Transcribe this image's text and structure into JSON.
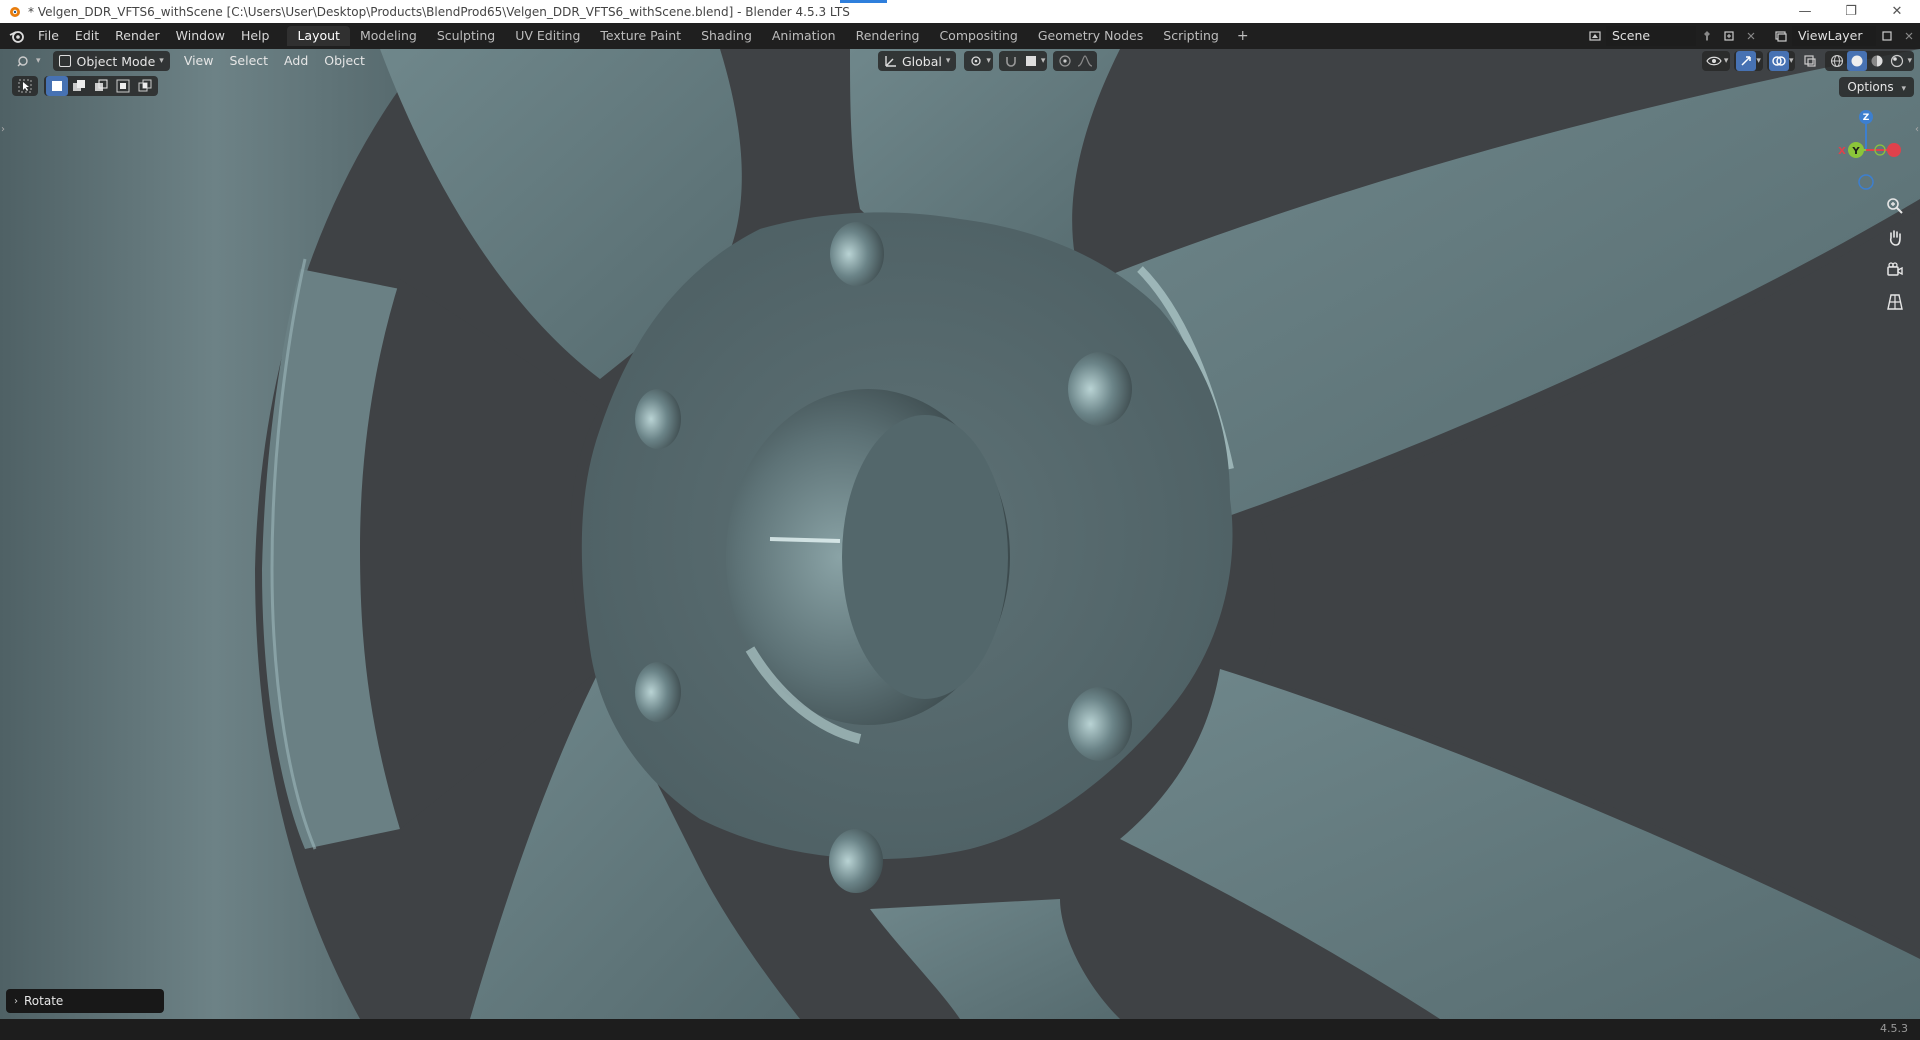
{
  "window": {
    "title": "* Velgen_DDR_VFTS6_withScene [C:\\Users\\User\\Desktop\\Products\\BlendProd65\\Velgen_DDR_VFTS6_withScene.blend] - Blender 4.5.3 LTS",
    "minimize": "—",
    "maximize": "❐",
    "close": "✕"
  },
  "menu": [
    "File",
    "Edit",
    "Render",
    "Window",
    "Help"
  ],
  "workspaces": {
    "tabs": [
      "Layout",
      "Modeling",
      "Sculpting",
      "UV Editing",
      "Texture Paint",
      "Shading",
      "Animation",
      "Rendering",
      "Compositing",
      "Geometry Nodes",
      "Scripting"
    ],
    "active": "Layout",
    "add": "+"
  },
  "scene": {
    "name": "Scene"
  },
  "view_layer": {
    "name": "ViewLayer"
  },
  "viewport_header": {
    "mode": "Object Mode",
    "menus": [
      "View",
      "Select",
      "Add",
      "Object"
    ],
    "orientation": "Global"
  },
  "options_label": "Options",
  "gizmo": {
    "z": "Z",
    "y": "Y",
    "x": "X"
  },
  "operator_panel": {
    "label": "Rotate"
  },
  "status": {
    "version": "4.5.3"
  },
  "colors": {
    "accent_blue": "#4772b3",
    "wheel_surface": "#5f7478",
    "background": "#3f4245",
    "axis_x": "#e0414c",
    "axis_y": "#8bc53a",
    "axis_z": "#3d7fcf"
  }
}
